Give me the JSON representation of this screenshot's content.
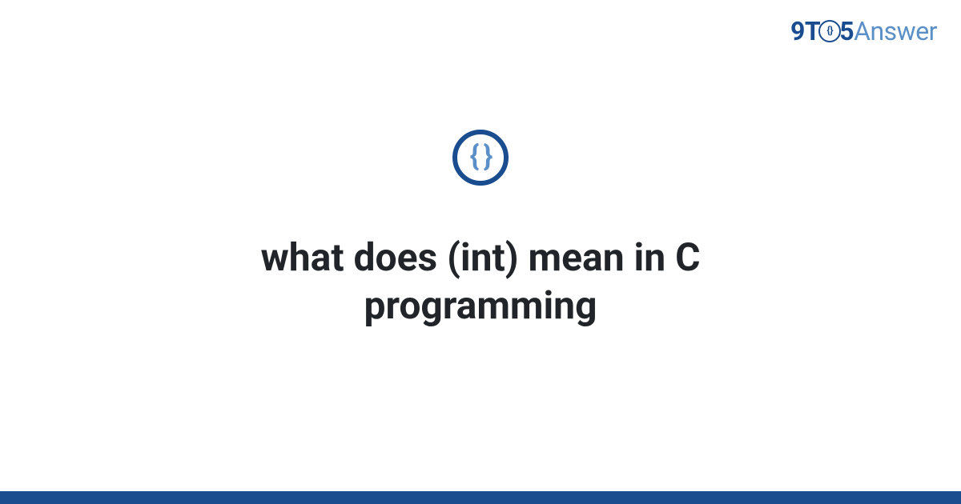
{
  "logo": {
    "part_9t": "9T",
    "circle_inner": "{}",
    "part_5": "5",
    "part_answer": "Answer"
  },
  "icon": {
    "braces": "{ }",
    "name": "code-braces-icon"
  },
  "question": {
    "title": "what does (int) mean in C programming"
  },
  "colors": {
    "primary_dark": "#1a4d8f",
    "primary_light": "#5a8fc7",
    "text": "#212529",
    "background": "#ffffff"
  }
}
